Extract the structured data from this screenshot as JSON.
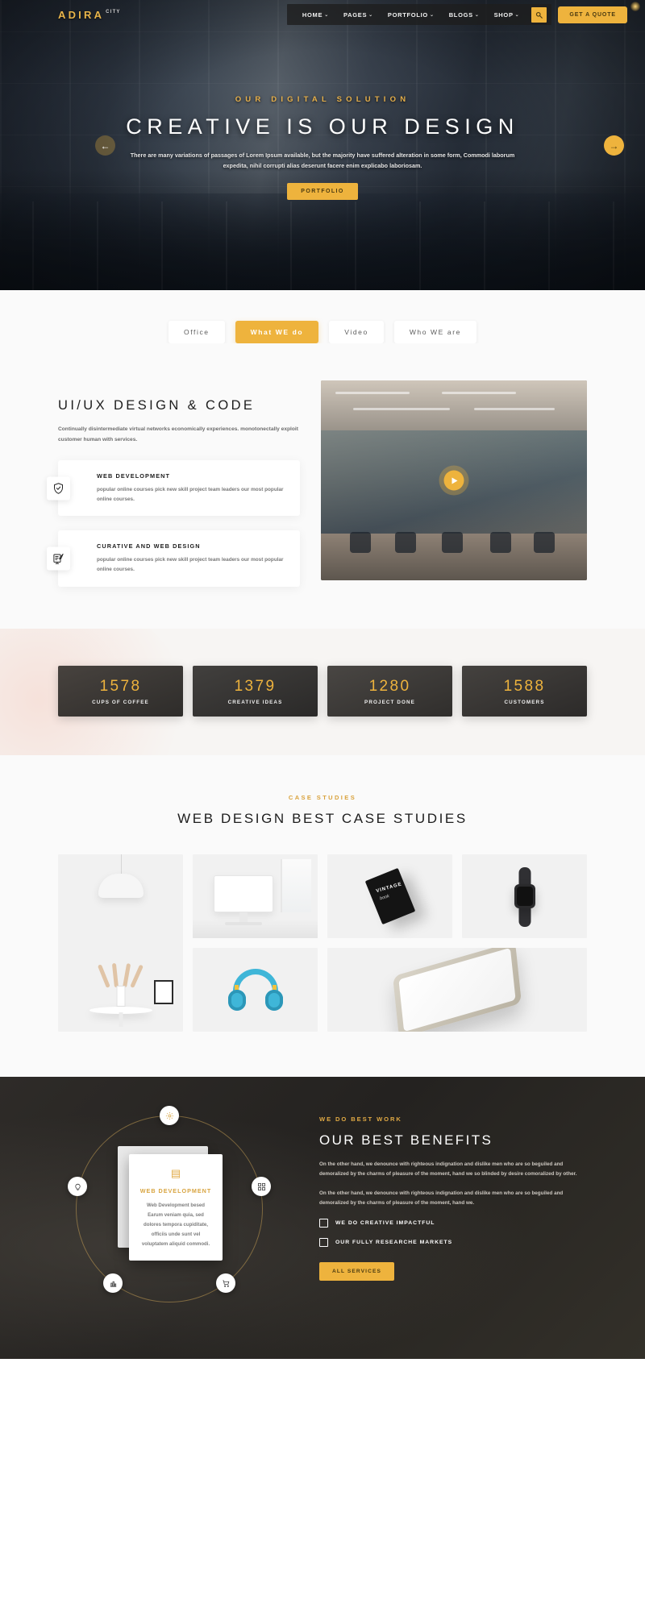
{
  "header": {
    "logo_main": "ADIRA",
    "logo_sub": "CITY",
    "nav": [
      {
        "label": "HOME",
        "caret": "⌄"
      },
      {
        "label": "PAGES",
        "caret": "⌄"
      },
      {
        "label": "PORTFOLIO",
        "caret": "⌄"
      },
      {
        "label": "BLOGS",
        "caret": "⌄"
      },
      {
        "label": "SHOP",
        "caret": "⌄"
      }
    ],
    "search_icon": "search-icon",
    "quote_button": "GET A QUOTE"
  },
  "hero": {
    "eyebrow": "OUR DIGITAL SOLUTION",
    "title": "CREATIVE IS OUR DESIGN",
    "paragraph": "There are many variations of passages of Lorem Ipsum available, but the majority have suffered alteration in some form, Commodi laborum expedita, nihil corrupti alias deserunt facere enim explicabo laboriosam.",
    "cta": "PORTFOLIO",
    "prev_arrow": "←",
    "next_arrow": "→"
  },
  "tabs": [
    {
      "label": "Office",
      "active": false
    },
    {
      "label": "What WE do",
      "active": true
    },
    {
      "label": "Video",
      "active": false
    },
    {
      "label": "Who WE are",
      "active": false
    }
  ],
  "uiux": {
    "title": "UI/UX DESIGN & CODE",
    "description": "Continually disintermediate virtual networks economically experiences. monotonectally exploit customer human with services.",
    "cards": [
      {
        "icon": "shield-check-icon",
        "title": "WEB DEVELOPMENT",
        "text": "popular online courses pick new skill project team leaders our most popular online courses."
      },
      {
        "icon": "design-pen-icon",
        "title": "CURATIVE AND WEB DESIGN",
        "text": "popular online courses pick new skill project team leaders our most popular online courses."
      }
    ],
    "video_play": "play-icon"
  },
  "stats": [
    {
      "number": "1578",
      "label": "CUPS OF COFFEE"
    },
    {
      "number": "1379",
      "label": "CREATIVE IDEAS"
    },
    {
      "number": "1280",
      "label": "PROJECT DONE"
    },
    {
      "number": "1588",
      "label": "CUSTOMERS"
    }
  ],
  "cases": {
    "eyebrow": "CASE STUDIES",
    "title": "WEB DESIGN BEST CASE STUDIES",
    "items": [
      {
        "name": "lamp-vase-photo"
      },
      {
        "name": "imac-desk-photo"
      },
      {
        "name": "vintage-book-photo",
        "book_title": "VINTAGE",
        "book_sub": "book"
      },
      {
        "name": "smart-watch-photo"
      },
      {
        "name": "blue-headphones-photo"
      },
      {
        "name": "gold-smartphone-photo"
      }
    ]
  },
  "benefits": {
    "eyebrow": "WE DO BEST WORK",
    "title": "OUR BEST BENEFITS",
    "paragraph1": "On the other hand, we denounce with righteous indignation and dislike men who are so beguiled and demoralized by the charms of pleasure of the moment, hand we so blinded by desire comoralized by other.",
    "paragraph2": "On the other hand, we denounce with righteous indignation and dislike men who are so beguiled and demoralized by the charms of pleasure of the moment, hand we.",
    "checks": [
      "WE DO CREATIVE IMPACTFUL",
      "OUR FULLY RESEARCHE MARKETS"
    ],
    "button": "ALL SERVICES",
    "card": {
      "icon": "document-icon",
      "title": "WEB DEVELOPMENT",
      "text": "Web Development besed Earum veniam quia, sed dolores tempora cupiditate, officiis unde sunt vel voluptatem aliquid commodi."
    },
    "nodes": [
      {
        "name": "gear-node-icon"
      },
      {
        "name": "bulb-node-icon"
      },
      {
        "name": "grid-node-icon"
      },
      {
        "name": "chart-node-icon"
      },
      {
        "name": "cart-node-icon"
      }
    ]
  },
  "colors": {
    "accent": "#eeb33d",
    "dark": "#2a2826",
    "text": "#1d1d1d"
  }
}
